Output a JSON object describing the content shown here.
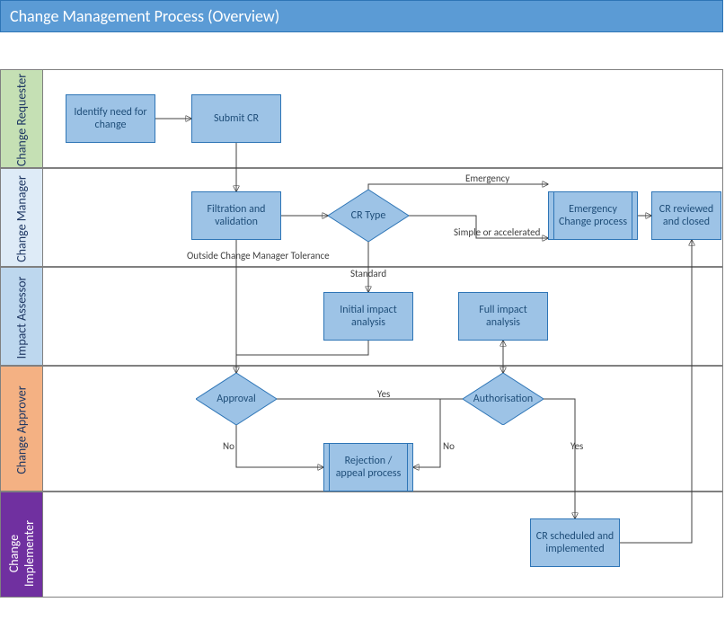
{
  "title": "Change Management Process (Overview)",
  "lanes": {
    "requester": "Change Requester",
    "manager": "Change Manager",
    "assessor": "Impact Assessor",
    "approver": "Change Approver",
    "implementer": "Change Implementer"
  },
  "nodes": {
    "identify": "Identify need for change",
    "submit": "Submit CR",
    "filtration": "Filtration and validation",
    "crtype": "CR Type",
    "emergency": "Emergency Change process",
    "reviewed": "CR  reviewed and closed",
    "initial": "Initial impact analysis",
    "full": "Full  impact analysis",
    "approval": "Approval",
    "authorisation": "Authorisation",
    "rejection": "Rejection / appeal process",
    "scheduled": "CR scheduled and implemented"
  },
  "edges": {
    "emergency": "Emergency",
    "simple": "Simple or accelerated",
    "standard": "Standard",
    "outside": "Outside Change Manager Tolerance",
    "yes": "Yes",
    "no": "No"
  }
}
